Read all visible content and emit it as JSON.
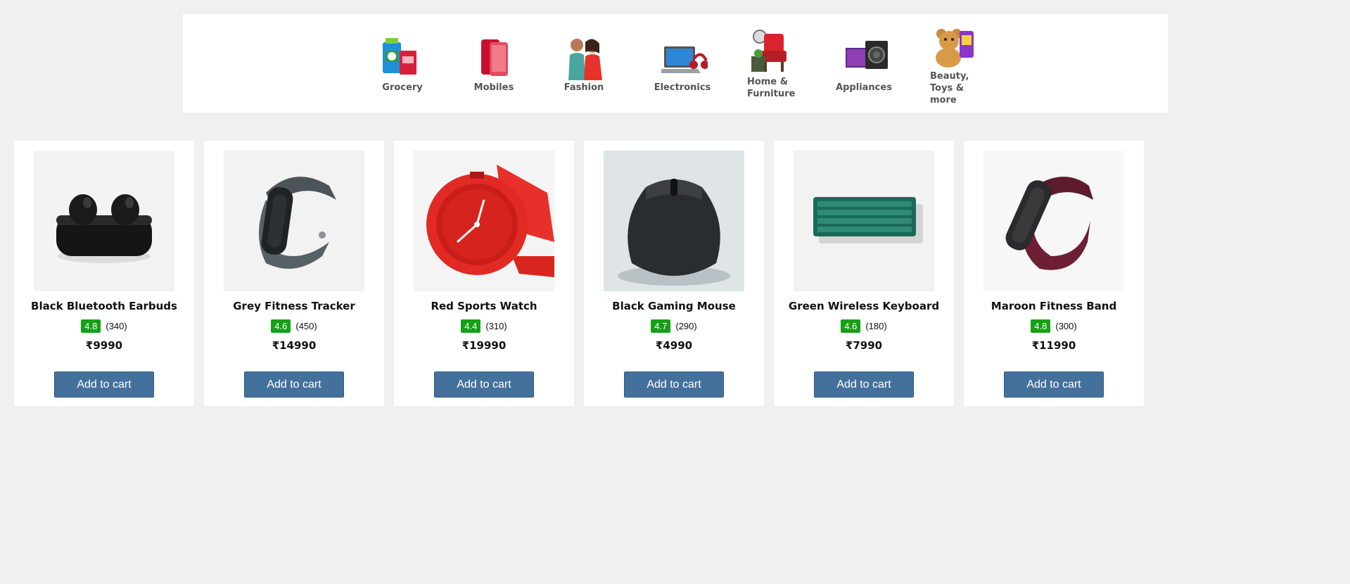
{
  "categories": [
    {
      "label": "Grocery",
      "icon": "grocery-icon"
    },
    {
      "label": "Mobiles",
      "icon": "mobile-phone-icon"
    },
    {
      "label": "Fashion",
      "icon": "fashion-icon"
    },
    {
      "label": "Electronics",
      "icon": "electronics-icon"
    },
    {
      "label": "Home &\nFurniture",
      "icon": "furniture-icon"
    },
    {
      "label": "Appliances",
      "icon": "appliances-icon"
    },
    {
      "label": "Beauty,\nToys &\nmore",
      "icon": "teddy-bear-icon"
    }
  ],
  "products": [
    {
      "name": "Black Bluetooth Earbuds",
      "rating": "4.8",
      "reviews": "(340)",
      "price": "₹9990",
      "button": "Add to cart",
      "image": "earbuds-image"
    },
    {
      "name": "Grey Fitness Tracker",
      "rating": "4.6",
      "reviews": "(450)",
      "price": "₹14990",
      "button": "Add to cart",
      "image": "fitness-tracker-image"
    },
    {
      "name": "Red Sports Watch",
      "rating": "4.4",
      "reviews": "(310)",
      "price": "₹19990",
      "button": "Add to cart",
      "image": "sports-watch-image"
    },
    {
      "name": "Black Gaming Mouse",
      "rating": "4.7",
      "reviews": "(290)",
      "price": "₹4990",
      "button": "Add to cart",
      "image": "gaming-mouse-image"
    },
    {
      "name": "Green Wireless Keyboard",
      "rating": "4.6",
      "reviews": "(180)",
      "price": "₹7990",
      "button": "Add to cart",
      "image": "keyboard-image"
    },
    {
      "name": "Maroon Fitness Band",
      "rating": "4.8",
      "reviews": "(300)",
      "price": "₹11990",
      "button": "Add to cart",
      "image": "fitness-band-image"
    }
  ],
  "colors": {
    "rating_badge": "#16a016",
    "button": "#44719c",
    "page_background": "#f0f0f0"
  }
}
